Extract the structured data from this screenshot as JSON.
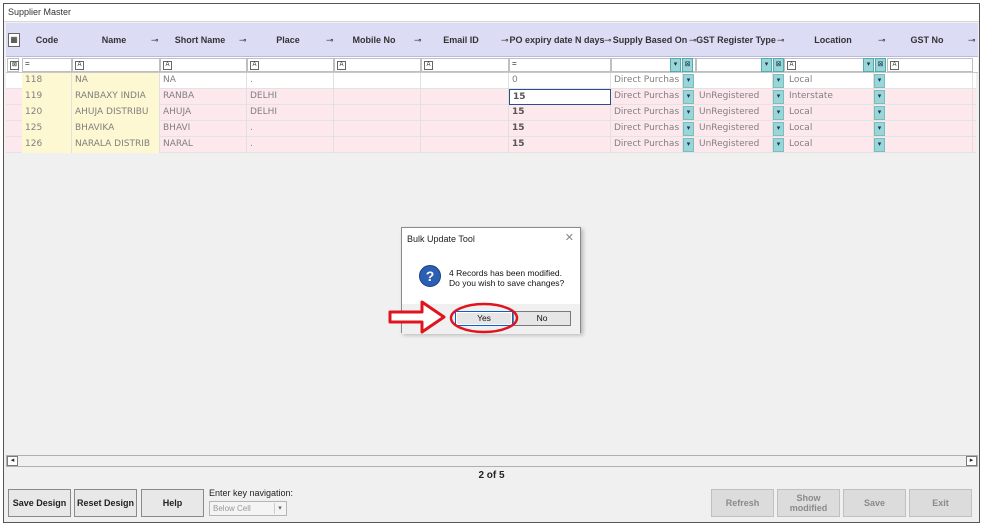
{
  "window": {
    "title": "Supplier Master"
  },
  "columns": [
    {
      "key": "code",
      "label": "Code"
    },
    {
      "key": "name",
      "label": "Name"
    },
    {
      "key": "short_name",
      "label": "Short Name"
    },
    {
      "key": "place",
      "label": "Place"
    },
    {
      "key": "mobile",
      "label": "Mobile No"
    },
    {
      "key": "email",
      "label": "Email ID"
    },
    {
      "key": "po_expiry",
      "label": "PO expiry date N days"
    },
    {
      "key": "supply_based_on",
      "label": "Supply Based On"
    },
    {
      "key": "gst_register_type",
      "label": "GST Register Type"
    },
    {
      "key": "location",
      "label": "Location"
    },
    {
      "key": "gst_no",
      "label": "GST No"
    }
  ],
  "filter": {
    "code_op": "=",
    "po_op": "="
  },
  "rows": [
    {
      "code": "118",
      "name": "NA",
      "short_name": "NA",
      "place": ".",
      "mobile": "",
      "email": "",
      "po_expiry": "0",
      "supply_based_on": "Direct Purchas",
      "gst_register_type": "",
      "location": "Local",
      "gst_no": ""
    },
    {
      "code": "119",
      "name": "RANBAXY INDIA",
      "short_name": "RANBA",
      "place": "DELHI",
      "mobile": "",
      "email": "",
      "po_expiry": "15",
      "supply_based_on": "Direct Purchas",
      "gst_register_type": "UnRegistered",
      "location": "Interstate",
      "gst_no": ""
    },
    {
      "code": "120",
      "name": "AHUJA DISTRIBU",
      "short_name": "AHUJA",
      "place": "DELHI",
      "mobile": "",
      "email": "",
      "po_expiry": "15",
      "supply_based_on": "Direct Purchas",
      "gst_register_type": "UnRegistered",
      "location": "Local",
      "gst_no": ""
    },
    {
      "code": "125",
      "name": "BHAVIKA",
      "short_name": "BHAVI",
      "place": ".",
      "mobile": "",
      "email": "",
      "po_expiry": "15",
      "supply_based_on": "Direct Purchas",
      "gst_register_type": "UnRegistered",
      "location": "Local",
      "gst_no": ""
    },
    {
      "code": "126",
      "name": "NARALA DISTRIB",
      "short_name": "NARAL",
      "place": ".",
      "mobile": "",
      "email": "",
      "po_expiry": "15",
      "supply_based_on": "Direct Purchas",
      "gst_register_type": "UnRegistered",
      "location": "Local",
      "gst_no": ""
    }
  ],
  "pager": {
    "text": "2 of 5"
  },
  "footer": {
    "save_design": "Save Design",
    "reset_design": "Reset Design",
    "help": "Help",
    "nav_label": "Enter key navigation:",
    "nav_value": "Below Cell",
    "refresh": "Refresh",
    "show_modified": "Show modified",
    "save": "Save",
    "exit": "Exit"
  },
  "dialog": {
    "title": "Bulk Update Tool",
    "line1": "4 Records has been modified.",
    "line2": "Do you wish to save changes?",
    "yes": "Yes",
    "no": "No"
  },
  "colors": {
    "header_bg": "#dcdcf5",
    "accent_cyan": "#99d6d9",
    "annotation_red": "#e0141e",
    "pink_row": "#fde8ee",
    "yellow_col": "#fdf7d2"
  },
  "icons": [
    "layout-icon",
    "pin-icon",
    "filter-text-icon",
    "clear-filter-icon",
    "dropdown-arrow-icon",
    "question-icon",
    "close-icon",
    "scroll-left-icon",
    "scroll-right-icon",
    "arrow-annotation-icon"
  ]
}
